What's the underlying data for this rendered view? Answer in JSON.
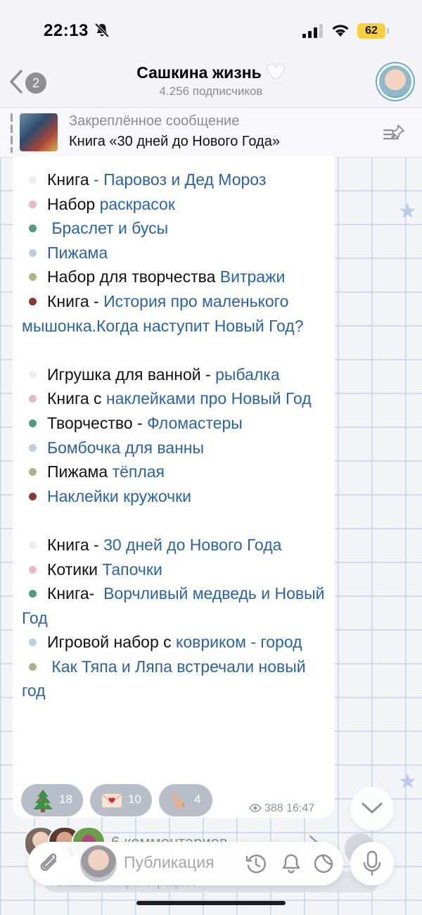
{
  "status_bar": {
    "time": "22:13",
    "battery": "62"
  },
  "header": {
    "back_count": "2",
    "title": "Сашкина жизнь",
    "subscribers": "4.256 подписчиков"
  },
  "pinned": {
    "label": "Закреплённое сообщение",
    "text": "Книга «30 дней до Нового Года»"
  },
  "message": {
    "lines": [
      {
        "dot": "#eceef2",
        "plain": "Книга",
        "link": " - Паровоз и Дед Мороз"
      },
      {
        "dot": "#e9b8c8",
        "plain": "Набор ",
        "link": "раскрасок"
      },
      {
        "dot": "#4f9a86",
        "plain": "",
        "link": " Браслет и бусы"
      },
      {
        "dot": "#b9d0e4",
        "plain": "",
        "link": "Пижама"
      },
      {
        "dot": "#a9b586",
        "plain": "Набор для творчества ",
        "link": "Витражи"
      },
      {
        "dot": "#8a3b2e",
        "plain": "Книга - ",
        "link": "История про маленького мышонка.Когда наступит Новый Год?"
      },
      {
        "blank": true
      },
      {
        "dot": "#eceef2",
        "plain": "Игрушка для ванной - ",
        "link": "рыбалка"
      },
      {
        "dot": "#e9b8c8",
        "plain": "Книга с ",
        "link": "наклейками про Новый Год"
      },
      {
        "dot": "#4f9a86",
        "plain": "Творчество - ",
        "link": "Фломастеры"
      },
      {
        "dot": "#b9d0e4",
        "plain": "",
        "link": "Бомбочка для ванны"
      },
      {
        "dot": "#a9b586",
        "plain": "Пижама ",
        "link": "тёплая"
      },
      {
        "dot": "#8a3b2e",
        "plain": "",
        "link": "Наклейки кружочки"
      },
      {
        "blank": true
      },
      {
        "dot": "#eceef2",
        "plain": "Книга - ",
        "link": "30 дней до Нового Года"
      },
      {
        "dot": "#e9b8c8",
        "plain": "Котики ",
        "link": "Тапочки"
      },
      {
        "dot": "#4f9a86",
        "plain": "Книга-  ",
        "link": "Ворчливый медведь и Новый Год"
      },
      {
        "dot": "#b9d0e4",
        "plain": "Игровой набор с ",
        "link": "ковриком - город"
      },
      {
        "dot": "#a9b586",
        "plain": "",
        "link": " Как Тяпа и Ляпа встречали новый год"
      }
    ]
  },
  "reactions": [
    {
      "icon": "christmas-tree-icon",
      "count": "18"
    },
    {
      "icon": "love-letter-icon",
      "count": "10"
    },
    {
      "icon": "pointing-hand-icon",
      "count": "4"
    }
  ],
  "meta": {
    "views": "388",
    "time": "16:47"
  },
  "comments": {
    "label": "6 комментариев"
  },
  "input": {
    "placeholder": "Публикация",
    "behind_text": "Сашка...  ...   фотографию"
  },
  "colors": {
    "link": "#2a62a8",
    "bell_icon": "#000",
    "subs_gray": "#8a8a8e"
  }
}
